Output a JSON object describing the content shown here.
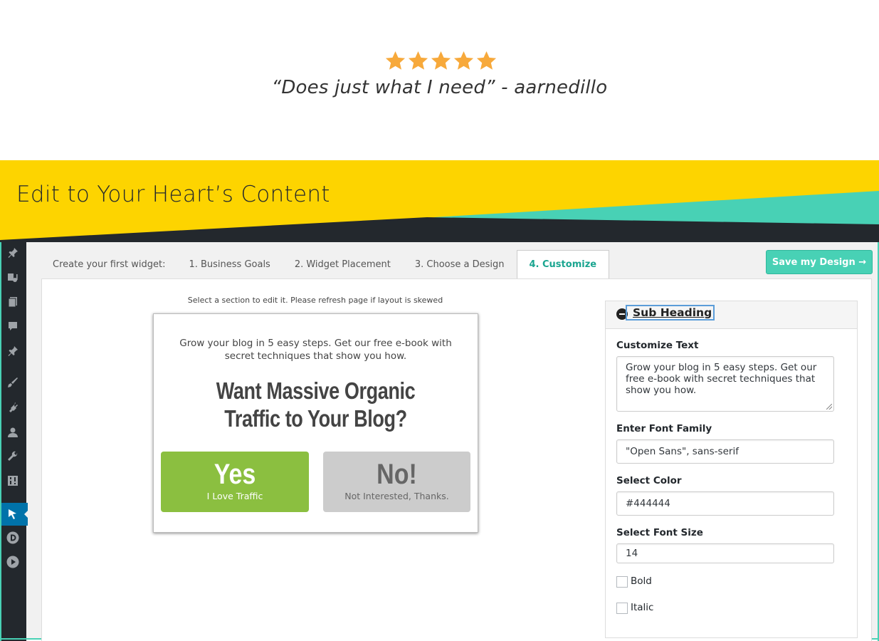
{
  "testimonial": {
    "rating": 5,
    "max_rating": 5,
    "quote": "“Does just what I need” - aarnedillo",
    "star_color": "#f7a93b"
  },
  "banner": {
    "title": "Edit to Your Heart’s Content",
    "colors": {
      "yellow": "#fdd400",
      "teal": "#48d1b5",
      "dark": "#23282d"
    }
  },
  "sidebar": {
    "items": [
      {
        "icon": "pin-icon"
      },
      {
        "icon": "media-icon"
      },
      {
        "icon": "pages-icon"
      },
      {
        "icon": "comments-icon"
      },
      {
        "icon": "pin-icon"
      },
      {
        "icon": "appearance-icon"
      },
      {
        "icon": "plugins-icon"
      },
      {
        "icon": "users-icon"
      },
      {
        "icon": "tools-icon"
      },
      {
        "icon": "settings-icon"
      },
      {
        "icon": "cursor-icon",
        "active": true
      },
      {
        "icon": "d-logo-icon"
      },
      {
        "icon": "play-icon"
      }
    ]
  },
  "tabs": {
    "intro": "Create your first widget:",
    "items": [
      {
        "label": "1. Business Goals"
      },
      {
        "label": "2. Widget Placement"
      },
      {
        "label": "3. Choose a Design"
      },
      {
        "label": "4. Customize",
        "active": true
      }
    ]
  },
  "save_button": "Save my Design →",
  "hint": "Select a section to edit it. Please refresh page if layout is skewed",
  "widget": {
    "subheading": "Grow your blog in 5 easy steps. Get our free e-book with secret techniques that show you how.",
    "heading_line1": "Want Massive Organic",
    "heading_line2": "Traffic to Your Blog?",
    "yes_big": "Yes",
    "yes_small": "I Love Traffic",
    "no_big": "No!",
    "no_small": "Not Interested, Thanks."
  },
  "customize": {
    "section_title": "Sub Heading",
    "text_label": "Customize Text",
    "text_value": "Grow your blog in 5 easy steps. Get our free e-book with secret techniques that show you how.",
    "font_family_label": "Enter Font Family",
    "font_family_value": "\"Open Sans\", sans-serif",
    "color_label": "Select Color",
    "color_value": "#444444",
    "font_size_label": "Select Font Size",
    "font_size_value": "14",
    "bold_label": "Bold",
    "bold_checked": false,
    "italic_label": "Italic",
    "italic_checked": false
  }
}
